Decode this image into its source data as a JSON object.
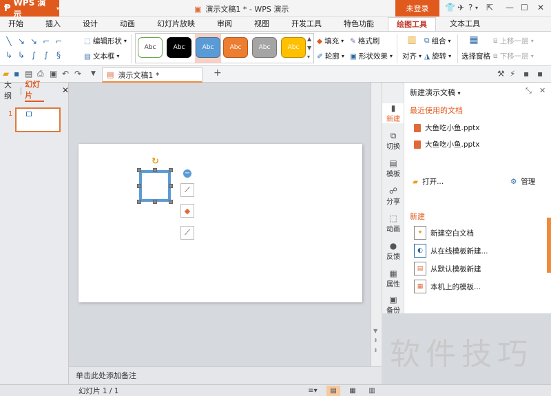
{
  "titlebar": {
    "app_name": "WPS 演示",
    "doc_title": "演示文稿1 * - WPS 演示",
    "login_label": "未登录"
  },
  "tabs": [
    "开始",
    "插入",
    "设计",
    "动画",
    "幻灯片放映",
    "审阅",
    "视图",
    "开发工具",
    "特色功能",
    "绘图工具",
    "文本工具"
  ],
  "active_tab": "绘图工具",
  "ribbon": {
    "edit_shape": "编辑形状",
    "text_box": "文本框",
    "style_sample": "Abc",
    "fill": "填充",
    "format_brush": "格式刷",
    "outline": "轮廓",
    "shape_effects": "形状效果",
    "align": "对齐",
    "group": "组合",
    "rotate": "旋转",
    "selection_pane": "选择窗格",
    "bring_forward": "上移一层",
    "send_backward": "下移一层"
  },
  "style_colors": [
    "#ffffff",
    "#000000",
    "#5b9bd5",
    "#ed7d31",
    "#a5a5a5",
    "#ffc000"
  ],
  "doc_tab_label": "演示文稿1 *",
  "left_panel": {
    "outline_tab": "大纲",
    "slides_tab": "幻灯片",
    "slide_number": "1"
  },
  "notes_placeholder": "单击此处添加备注",
  "status": {
    "slide_info": "幻灯片 1 / 1"
  },
  "side_strip": [
    "新建",
    "切换",
    "模板",
    "分享",
    "动画",
    "反馈",
    "属性",
    "备份"
  ],
  "task_pane": {
    "title": "新建演示文稿",
    "recent_header": "最近使用的文档",
    "recent_files": [
      "大鱼吃小鱼.pptx",
      "大鱼吃小鱼.pptx"
    ],
    "open_label": "打开...",
    "manage_label": "管理",
    "new_header": "新建",
    "new_items": [
      "新建空白文档",
      "从在线模板新建...",
      "从默认模板新建",
      "本机上的模板..."
    ]
  },
  "watermark": "软件技巧",
  "colors": {
    "accent": "#e05a1e",
    "shape_blue": "#5b9bd5"
  }
}
